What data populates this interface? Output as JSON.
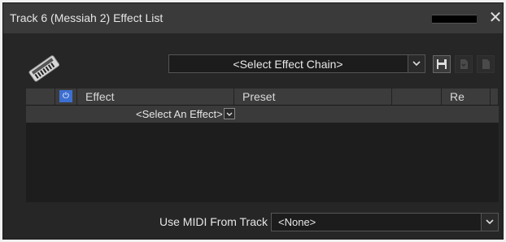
{
  "window": {
    "title": "Track 6 (Messiah 2) Effect List",
    "close_glyph": "✕"
  },
  "toolbar": {
    "effect_chain": {
      "value": "<Select Effect Chain>"
    },
    "save_icon": "save-icon",
    "other_icons": [
      "load-chain-icon",
      "delete-chain-icon"
    ]
  },
  "table": {
    "columns": [
      "",
      "",
      "Effect",
      "Preset",
      "",
      "Re",
      ""
    ],
    "power_glyph": "⏻",
    "select_effect": "<Select An Effect>"
  },
  "footer": {
    "label": "Use MIDI From Track :",
    "track_value": "<None>"
  },
  "colors": {
    "accent": "#3d6fd1",
    "bg": "#262626",
    "header": "#3a3a3a"
  }
}
